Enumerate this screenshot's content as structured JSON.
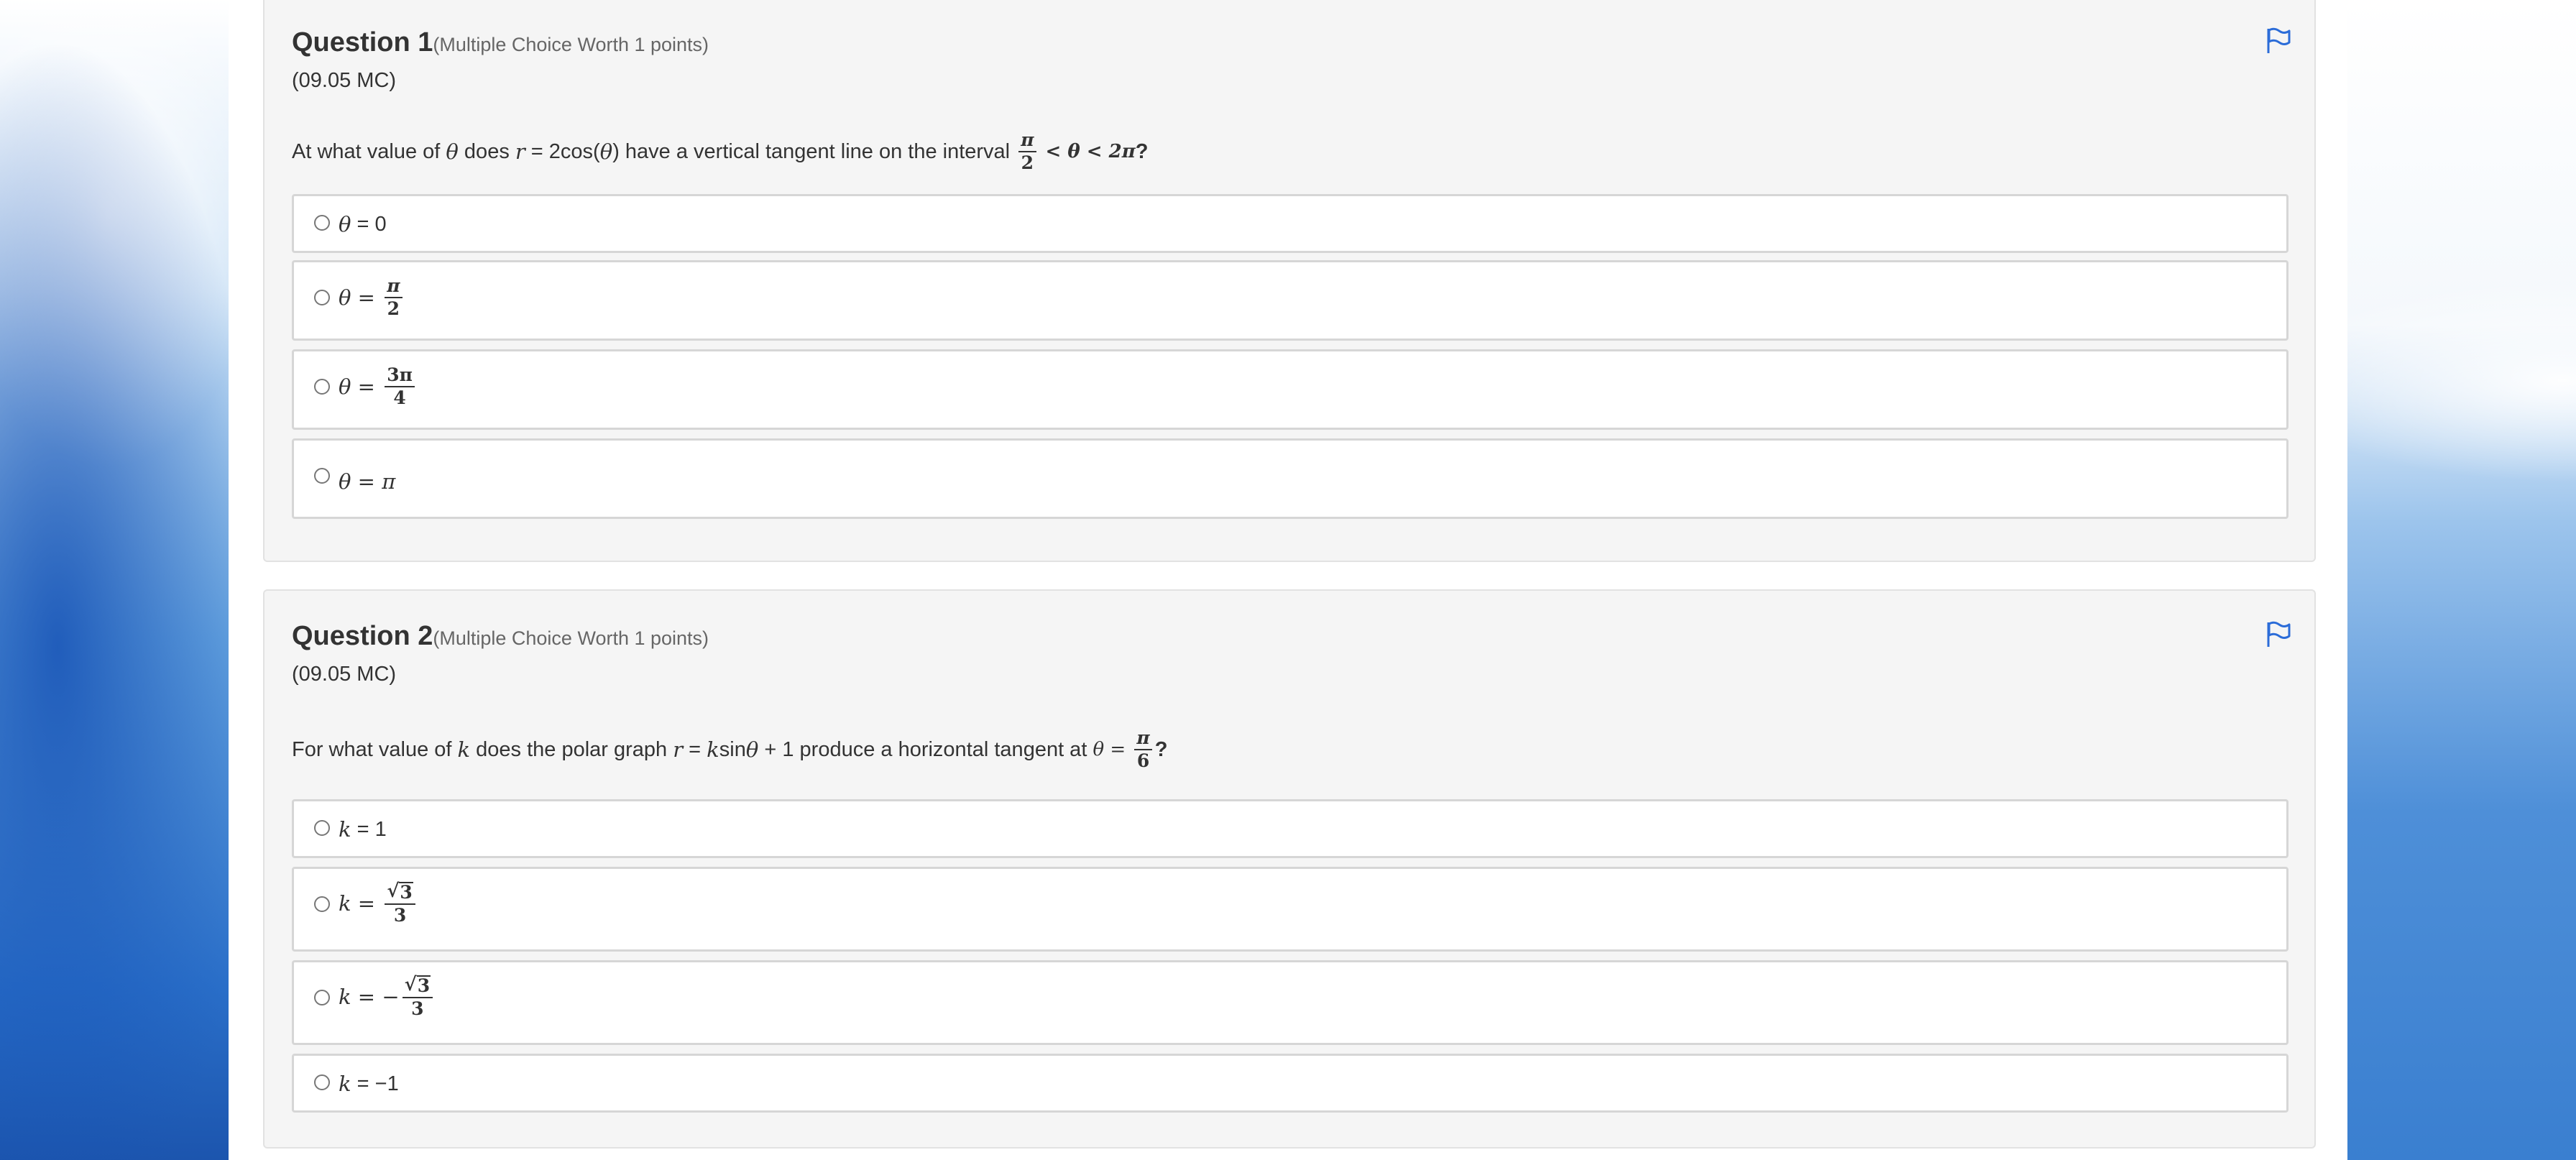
{
  "colors": {
    "panel_bg": "#f5f5f5",
    "option_border": "#d6d6d6",
    "text": "#333333",
    "muted": "#666666",
    "flag_blue": "#2b6cd8"
  },
  "q1": {
    "title": "Question 1",
    "worth": "(Multiple Choice Worth 1 points)",
    "code": "(09.05 MC)",
    "text_before": "At what value of ",
    "text_theta": "θ",
    "text_mid1": " does ",
    "text_r": "r",
    "text_mid2": " = 2cos(",
    "text_theta2": "θ",
    "text_mid3": ") have a vertical tangent line on the interval ",
    "interval_num": "π",
    "interval_den": "2",
    "interval_rest": " < θ < 2π",
    "text_end": "?",
    "options": {
      "a_var": "θ",
      "a_rest": " = 0",
      "b_var": "θ",
      "b_eq": " = ",
      "b_num": "π",
      "b_den": "2",
      "c_var": "θ",
      "c_eq": " = ",
      "c_num": "3π",
      "c_den": "4",
      "d_var": "θ",
      "d_eq": " = ",
      "d_val": "π"
    },
    "flag_icon": "flag-icon"
  },
  "q2": {
    "title": "Question 2",
    "worth": "(Multiple Choice Worth 1 points)",
    "code": "(09.05 MC)",
    "text_before": "For what value of ",
    "text_k": "k",
    "text_mid1": " does the polar graph ",
    "text_r": "r",
    "text_mid2": " = ",
    "text_k2": "k",
    "text_mid3": "sin",
    "text_theta": "θ",
    "text_mid4": " + 1 produce a horizontal tangent at ",
    "at_var": "θ",
    "at_eq": " = ",
    "at_num": "π",
    "at_den": "6",
    "text_end": "?",
    "options": {
      "a_var": "k",
      "a_rest": " = 1",
      "b_var": "k",
      "b_eq": " = ",
      "b_num": "3",
      "b_den": "3",
      "c_var": "k",
      "c_eq": " = −",
      "c_num": "3",
      "c_den": "3",
      "d_var": "k",
      "d_rest": " = −1"
    },
    "flag_icon": "flag-icon"
  }
}
